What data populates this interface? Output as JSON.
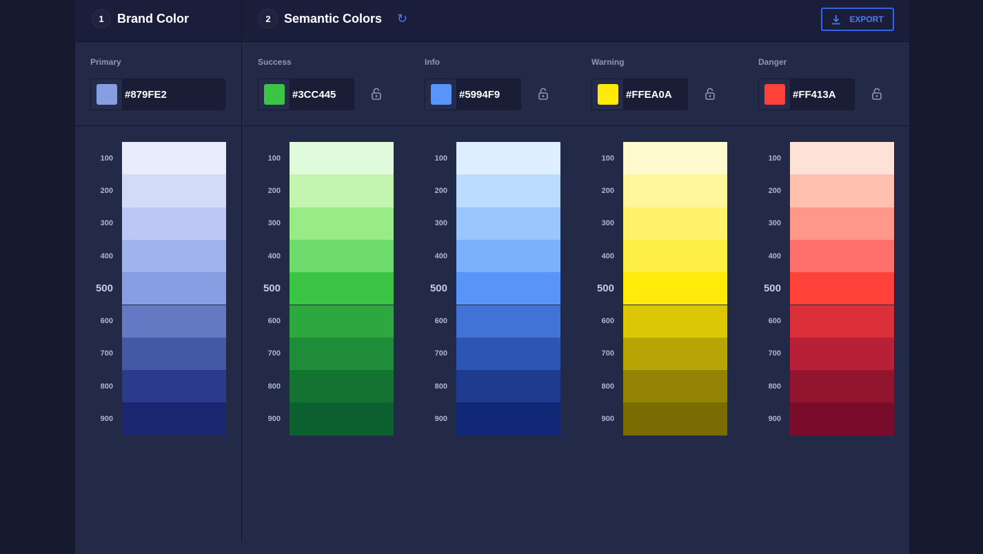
{
  "header": {
    "step1": {
      "num": "1",
      "title": "Brand Color"
    },
    "step2": {
      "num": "2",
      "title": "Semantic Colors"
    },
    "export_label": "EXPORT"
  },
  "shade_labels": [
    "100",
    "200",
    "300",
    "400",
    "500",
    "600",
    "700",
    "800",
    "900"
  ],
  "groups": [
    {
      "label": "Primary",
      "hex": "#879FE2",
      "locked": null,
      "shades": [
        "#e9ecfb",
        "#d2dcf8",
        "#bcc8f3",
        "#a0b3ee",
        "#879fe2",
        "#6379c4",
        "#4459a6",
        "#2b3a8b",
        "#1b2670"
      ]
    },
    {
      "label": "Success",
      "hex": "#3CC445",
      "locked": false,
      "shades": [
        "#e0fbdc",
        "#c4f5b0",
        "#98ec88",
        "#6cdb6c",
        "#3cc445",
        "#2da83f",
        "#1e8c38",
        "#157331",
        "#0c5f2e"
      ]
    },
    {
      "label": "Info",
      "hex": "#5994F9",
      "locked": false,
      "shades": [
        "#ddeeff",
        "#bcdcfe",
        "#9ac6fd",
        "#7bb0fb",
        "#5994f9",
        "#4173d6",
        "#2d55b3",
        "#1e3b90",
        "#112877"
      ]
    },
    {
      "label": "Warning",
      "hex": "#FFEA0A",
      "locked": false,
      "shades": [
        "#fffacd",
        "#fff69c",
        "#fff36b",
        "#ffef45",
        "#ffea0a",
        "#dbc706",
        "#b7a405",
        "#938203",
        "#7a6b02"
      ]
    },
    {
      "label": "Danger",
      "hex": "#FF413A",
      "locked": false,
      "shades": [
        "#ffe2d7",
        "#ffc0b0",
        "#ff9888",
        "#ff706a",
        "#ff413a",
        "#db2f3a",
        "#b72036",
        "#93142f",
        "#7a0c2b"
      ]
    }
  ]
}
